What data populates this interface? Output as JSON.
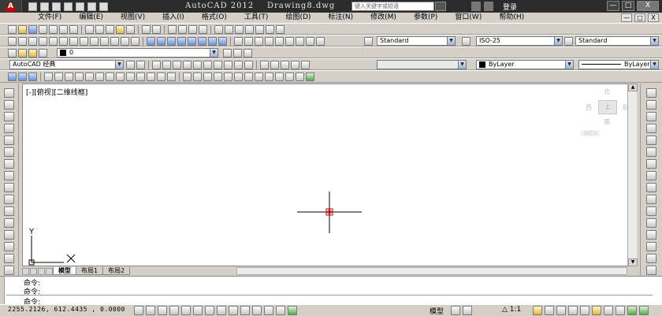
{
  "app": {
    "logo_letter": "A",
    "title": "AutoCAD 2012",
    "document": "Drawing8.dwg",
    "search_placeholder": "键入关键字或短语",
    "login_label": "登录"
  },
  "window_controls": [
    "—",
    "□",
    "X"
  ],
  "menus": [
    "文件(F)",
    "编辑(E)",
    "视图(V)",
    "插入(I)",
    "格式(O)",
    "工具(T)",
    "绘图(D)",
    "标注(N)",
    "修改(M)",
    "参数(P)",
    "窗口(W)",
    "帮助(H)"
  ],
  "styles": {
    "text_style": "Standard",
    "dim_style": "ISO-25",
    "table_style": "Standard"
  },
  "layer": {
    "current": "0"
  },
  "workspace": "AutoCAD 经典",
  "properties": {
    "color": "ByLayer",
    "linetype": "ByLayer"
  },
  "viewport": {
    "label": "[-][俯视][二维线框]"
  },
  "viewcube": {
    "north": "北",
    "south": "南",
    "east": "东",
    "west": "西",
    "face": "上",
    "wcs": "WCS"
  },
  "ucs": {
    "y_label": "Y"
  },
  "tabs": [
    "模型",
    "布局1",
    "布局2"
  ],
  "command": {
    "lines": [
      "命令:",
      "命令:",
      "命令:"
    ]
  },
  "status": {
    "coordinates": "2255.2126, 612.4435 , 0.0000",
    "model": "模型",
    "scale": "1:1"
  },
  "colors": {
    "titlebar": "#2b2b2b",
    "canvas": "#ffffff",
    "crosshair": "#000000",
    "crosshair_center": "#c00000",
    "ui_gray": "#d4d0c8"
  }
}
